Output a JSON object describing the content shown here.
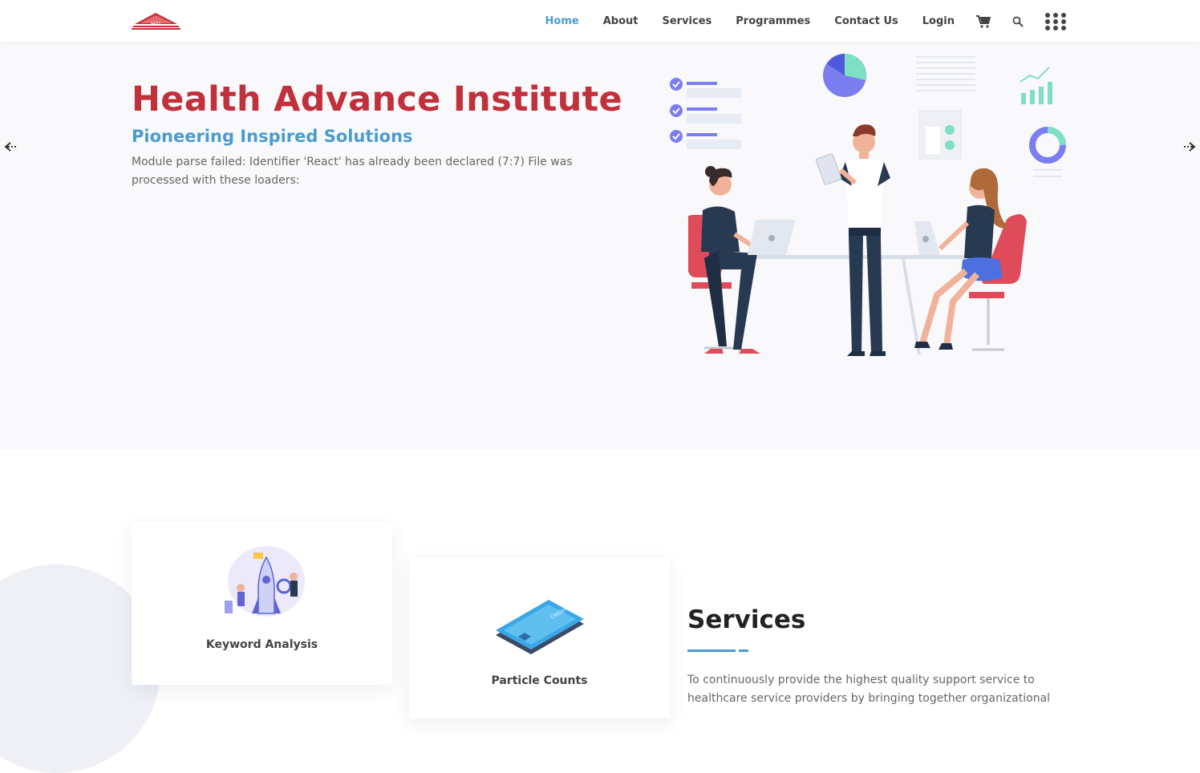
{
  "header": {
    "logo_text": "HAI",
    "nav": [
      {
        "label": "Home",
        "active": true
      },
      {
        "label": "About",
        "active": false
      },
      {
        "label": "Services",
        "active": false
      },
      {
        "label": "Programmes",
        "active": false
      },
      {
        "label": "Contact Us",
        "active": false
      },
      {
        "label": "Login",
        "active": false
      }
    ],
    "icons": [
      "cart-icon",
      "search-icon",
      "grid-menu-icon"
    ]
  },
  "hero": {
    "title": "Health Advance Institute",
    "subtitle": "Pioneering Inspired Solutions",
    "description": "Module parse failed: Identifier 'React' has already been declared (7:7) File was processed with these loaders:"
  },
  "cards": [
    {
      "title": "Keyword Analysis"
    },
    {
      "title": "Particle Counts"
    }
  ],
  "services": {
    "title": "Services",
    "text": "To continuously provide the highest quality support service to healthcare service providers by bringing together organizational"
  },
  "colors": {
    "brand_red": "#c0313b",
    "accent_blue": "#4b9bd1",
    "hero_bg": "#f9f9fb"
  }
}
